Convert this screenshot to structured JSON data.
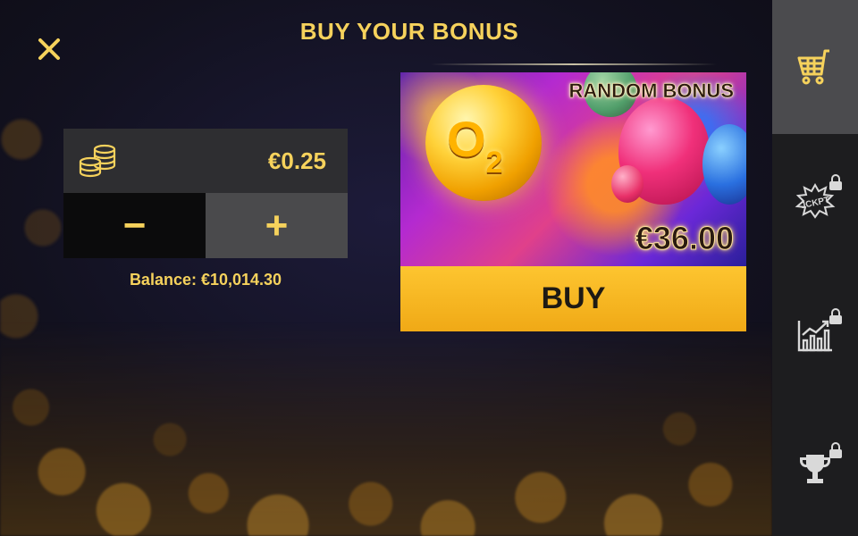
{
  "header": {
    "title": "BUY YOUR BONUS"
  },
  "icons": {
    "close": "close-icon",
    "coins": "coin-stack-icon",
    "cart": "shopping-cart-icon",
    "jackpot": "jackpot-icon",
    "chart": "growth-chart-icon",
    "trophy": "trophy-icon",
    "lock": "lock-icon"
  },
  "bet": {
    "value": "€0.25",
    "minus_label": "−",
    "plus_label": "+",
    "balance": "Balance: €10,014.30"
  },
  "bonus": {
    "label": "RANDOM BONUS",
    "price": "€36.00",
    "buy_label": "BUY",
    "image_text_main": "O",
    "image_text_sub": "2"
  },
  "sidebar": {
    "items": [
      {
        "name": "cart",
        "active": true,
        "locked": false
      },
      {
        "name": "jackpot",
        "active": false,
        "locked": true,
        "text": "JCKPT"
      },
      {
        "name": "chart",
        "active": false,
        "locked": true
      },
      {
        "name": "trophy",
        "active": false,
        "locked": true
      }
    ]
  },
  "colors": {
    "accent_yellow": "#f6d25c",
    "buy_button": "#fdc530",
    "sidebar_bg": "#1d1d1f",
    "sidebar_active": "#4b4b4e"
  }
}
